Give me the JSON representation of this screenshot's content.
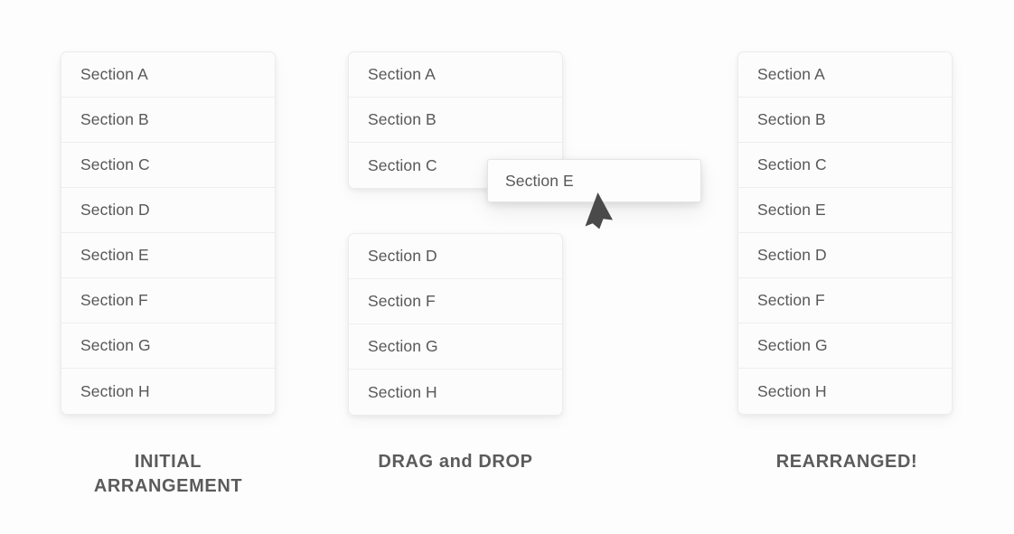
{
  "background_color": "#fdfdfd",
  "text_color": "#585858",
  "caption_color": "#5b5b5b",
  "cursor_color": "#4a4a4a",
  "columns": {
    "initial": {
      "caption_line1": "INITIAL",
      "caption_line2": "ARRANGEMENT",
      "groups": [
        {
          "items": [
            "Section A",
            "Section B",
            "Section C",
            "Section D",
            "Section E",
            "Section F",
            "Section G",
            "Section H"
          ]
        }
      ]
    },
    "dragdrop": {
      "caption_line1": "DRAG and DROP",
      "caption_line2": "",
      "groups": [
        {
          "items": [
            "Section A",
            "Section B",
            "Section C"
          ]
        },
        {
          "items": [
            "Section D",
            "Section F",
            "Section G",
            "Section H"
          ]
        }
      ],
      "dragged_item": "Section E"
    },
    "rearranged": {
      "caption_line1": "REARRANGED!",
      "caption_line2": "",
      "groups": [
        {
          "items": [
            "Section A",
            "Section B",
            "Section C",
            "Section E",
            "Section D",
            "Section F",
            "Section G",
            "Section H"
          ]
        }
      ]
    }
  }
}
